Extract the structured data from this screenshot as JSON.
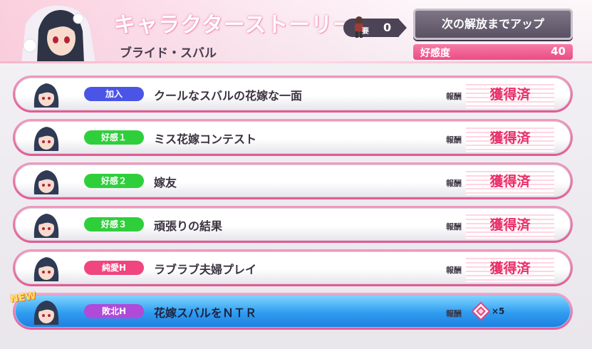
{
  "header": {
    "title": "キャラクターストーリー",
    "subtitle": "ブライド・スバル",
    "requirement": {
      "label": "要",
      "value": "0"
    },
    "unlock_button": "次の解放までアップ",
    "affinity": {
      "label": "好感度",
      "value": "40"
    }
  },
  "common": {
    "reward_label": "報酬",
    "acquired_label": "獲得済",
    "new_badge": "NEW"
  },
  "stories": [
    {
      "tag": "加入",
      "title": "クールなスバルの花嫁な一面"
    },
    {
      "tag": "好感１",
      "title": "ミス花嫁コンテスト"
    },
    {
      "tag": "好感２",
      "title": "嫁友"
    },
    {
      "tag": "好感３",
      "title": "頑張りの結果"
    },
    {
      "tag": "純愛H",
      "title": "ラブラブ夫婦プレイ"
    },
    {
      "tag": "敗北H",
      "title": "花嫁スバルをＮＴＲ",
      "reward": "×5"
    }
  ],
  "colors": {
    "accent": "#ea4d85",
    "tag_blue": "#4a55e6",
    "tag_green": "#2fcf3c",
    "tag_pink": "#f0457e",
    "tag_purple": "#b04ad8"
  },
  "icons": [
    "portrait-icon",
    "chibi-icon",
    "gem-icon",
    "requirement-figure-icon"
  ]
}
